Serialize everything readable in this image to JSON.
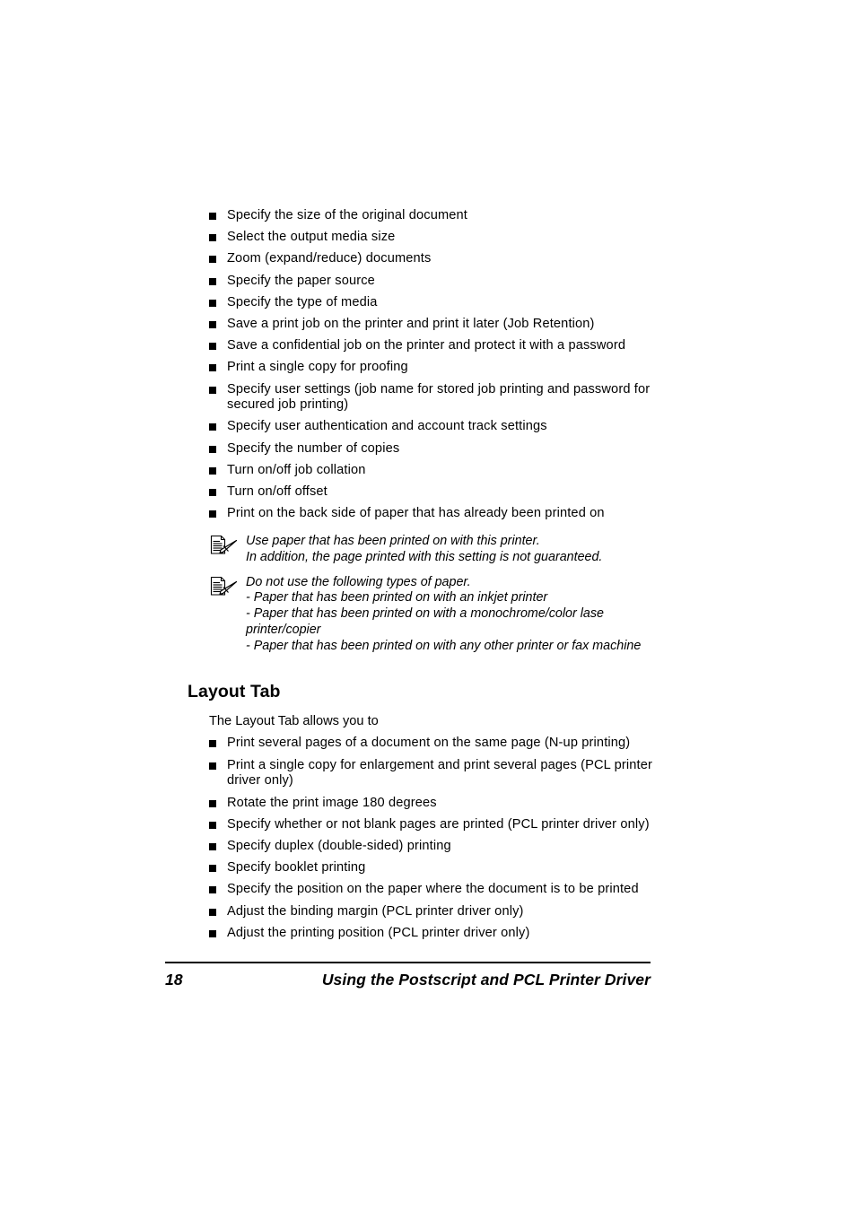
{
  "document": {
    "page_number": "18",
    "footer_title": "Using the Postscript and PCL Printer Driver"
  },
  "driver_features": {
    "items": [
      "Specify the size of the original document",
      "Select the output media size",
      "Zoom (expand/reduce) documents",
      "Specify the paper source",
      "Specify the type of media",
      "Save a print job on the printer and print it later (Job Retention)",
      "Save a confidential job on the printer and protect it with a password",
      "Print a single copy for proofing",
      "Specify user settings (job name for stored job printing and password for secured job printing)",
      "Specify user authentication and account track settings",
      "Specify the number of copies",
      "Turn on/off job collation",
      "Turn on/off offset",
      "Print on the back side of paper that has already been printed on"
    ]
  },
  "notes": [
    {
      "icon": "note-pencil-icon",
      "lines": [
        "Use paper that has been printed on with this printer.",
        "In addition, the page printed with this setting is not guaranteed."
      ]
    },
    {
      "icon": "note-pencil-icon",
      "lines": [
        "Do not use the following types of paper.",
        "- Paper that has been printed on with an inkjet printer",
        "- Paper that has been printed on with a monochrome/color lase",
        "printer/copier",
        "- Paper that has been printed on with any other printer or fax machine"
      ]
    }
  ],
  "layout_tab": {
    "heading": "Layout Tab",
    "intro": "The Layout Tab allows you to",
    "items": [
      "Print several pages of a document on the same page (N-up printing)",
      "Print a single copy for enlargement and print several pages (PCL printer driver only)",
      "Rotate the print image 180 degrees",
      "Specify whether or not blank pages are printed (PCL printer driver only)",
      "Specify duplex (double-sided) printing",
      "Specify booklet printing",
      "Specify the position on the paper where the document is to be printed",
      "Adjust the binding margin (PCL printer driver only)",
      "Adjust the printing position (PCL printer driver only)"
    ]
  },
  "colors": {
    "text": "#000000",
    "background": "#ffffff",
    "rule": "#000000"
  }
}
